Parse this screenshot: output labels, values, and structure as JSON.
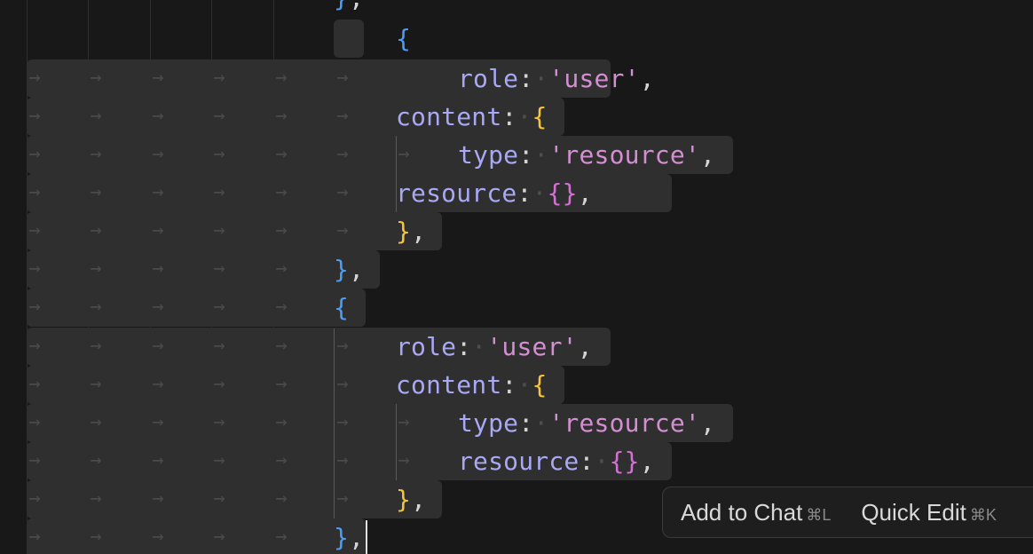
{
  "editor": {
    "lines": [
      [
        [
          "brace-blue",
          "}"
        ],
        [
          "punc",
          ","
        ]
      ],
      [
        [
          "brace-blue",
          "{"
        ]
      ],
      [
        [
          "key",
          "role"
        ],
        [
          "punc",
          ":"
        ],
        [
          "ws",
          " "
        ],
        [
          "str",
          "'user'"
        ],
        [
          "punc",
          ","
        ]
      ],
      [
        [
          "key",
          "content"
        ],
        [
          "punc",
          ":"
        ],
        [
          "ws",
          " "
        ],
        [
          "brace-yellow",
          "{"
        ]
      ],
      [
        [
          "key",
          "type"
        ],
        [
          "punc",
          ":"
        ],
        [
          "ws",
          " "
        ],
        [
          "str",
          "'resource'"
        ],
        [
          "punc",
          ","
        ]
      ],
      [
        [
          "key",
          "resource"
        ],
        [
          "punc",
          ":"
        ],
        [
          "ws",
          " "
        ],
        [
          "brace-pink",
          "{}"
        ],
        [
          "punc",
          ","
        ]
      ],
      [
        [
          "brace-yellow",
          "}"
        ],
        [
          "punc",
          ","
        ]
      ],
      [
        [
          "brace-blue",
          "}"
        ],
        [
          "punc",
          ","
        ]
      ],
      [
        [
          "brace-blue",
          "{"
        ]
      ],
      [
        [
          "key",
          "role"
        ],
        [
          "punc",
          ":"
        ],
        [
          "ws",
          " "
        ],
        [
          "str",
          "'user'"
        ],
        [
          "punc",
          ","
        ]
      ],
      [
        [
          "key",
          "content"
        ],
        [
          "punc",
          ":"
        ],
        [
          "ws",
          " "
        ],
        [
          "brace-yellow",
          "{"
        ]
      ],
      [
        [
          "key",
          "type"
        ],
        [
          "punc",
          ":"
        ],
        [
          "ws",
          " "
        ],
        [
          "str",
          "'resource'"
        ],
        [
          "punc",
          ","
        ]
      ],
      [
        [
          "key",
          "resource"
        ],
        [
          "punc",
          ":"
        ],
        [
          "ws",
          " "
        ],
        [
          "brace-pink",
          "{}"
        ],
        [
          "punc",
          ","
        ]
      ],
      [
        [
          "brace-yellow",
          "}"
        ],
        [
          "punc",
          ","
        ]
      ],
      [
        [
          "brace-blue",
          "}"
        ],
        [
          "punc",
          ","
        ]
      ]
    ],
    "tab_glyph": "→",
    "whitespace_glyph": "·",
    "colors": {
      "background": "#181818",
      "selection": "#2f2f2f",
      "key": "#a8a8f4",
      "string": "#d48fd2",
      "brace_blue": "#4c9df3",
      "brace_yellow": "#f3c43c",
      "brace_pink": "#d46fd4"
    }
  },
  "popup": {
    "add_to_chat": {
      "label": "Add to Chat",
      "shortcut": "⌘L"
    },
    "quick_edit": {
      "label": "Quick Edit",
      "shortcut": "⌘K"
    }
  }
}
